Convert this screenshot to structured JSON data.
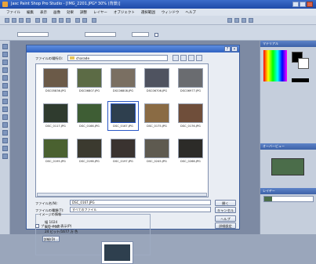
{
  "app": {
    "title": "Jasc Paint Shop Pro Studio - [IMG_2201.JPG* 30% (背景)]",
    "menu": [
      "ファイル",
      "編集",
      "表示",
      "画像",
      "効果",
      "調整",
      "レイヤー",
      "オブジェクト",
      "選択範囲",
      "ウィンドウ",
      "ヘルプ"
    ]
  },
  "panels": {
    "color_title": "マテリアル",
    "overview_title": "オーバービュー",
    "layers_title": "レイヤー"
  },
  "dialog": {
    "lookin_label": "ファイルの場所(I):",
    "lookin_value": "charade",
    "files": [
      {
        "name": "DSC05836.JPG",
        "color": "#6b5a48"
      },
      {
        "name": "DSC06807.JPG",
        "color": "#5c6b45"
      },
      {
        "name": "DSC06808.JPG",
        "color": "#7a6f62"
      },
      {
        "name": "DSC06706.JPG",
        "color": "#4f5360"
      },
      {
        "name": "DSC06977.JPG",
        "color": "#6a6c70"
      },
      {
        "name": "DSC_0117.JPG",
        "color": "#2f3b2e"
      },
      {
        "name": "DSC_0166.JPG",
        "color": "#3e5d34"
      },
      {
        "name": "DSC_0167.JPG",
        "color": "#2e3f4e"
      },
      {
        "name": "DSC_0175.JPG",
        "color": "#8a6b44"
      },
      {
        "name": "DSC_0176.JPG",
        "color": "#6f4e3a"
      },
      {
        "name": "DSC_0195.JPG",
        "color": "#4a6130"
      },
      {
        "name": "DSC_0196.JPG",
        "color": "#3b3a2f"
      },
      {
        "name": "DSC_0197.JPG",
        "color": "#3a3330"
      },
      {
        "name": "DSC_0245.JPG",
        "color": "#5e5a50"
      },
      {
        "name": "DSC_0266.JPG",
        "color": "#2c2b28"
      }
    ],
    "filename_label": "ファイル名(N):",
    "filename_value": "DSC_0167.JPG",
    "filetype_label": "ファイルの種類(T):",
    "filetype_value": "すべてのファイル",
    "open_button": "開く",
    "cancel_button": "キャンセル",
    "help_button": "ヘルプ",
    "details_button": "詳細設定",
    "info_group_title": "イメージの情報",
    "info_line1": "幅 1024",
    "info_line2": "高さ 768",
    "info_line3": "24 ビット/1677 万 色",
    "info_link": "詳細(D)...",
    "preview_checkbox_label": "プレビューを表示(P)"
  }
}
